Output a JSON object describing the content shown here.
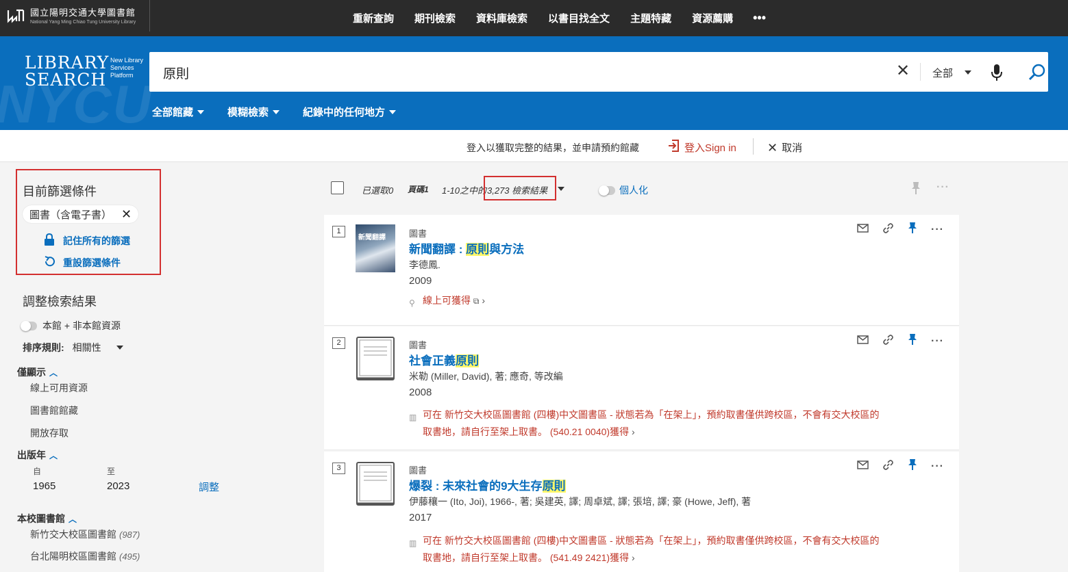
{
  "topbar": {
    "logo_zh": "國立陽明交通大學圖書館",
    "logo_en": "National Yang Ming Chiao Tung University Library",
    "nav": [
      "重新查詢",
      "期刊檢索",
      "資料庫檢索",
      "以書目找全文",
      "主題特藏",
      "資源薦購"
    ],
    "more": "•••"
  },
  "header": {
    "brand_line1": "LIBRARY",
    "brand_line2": "SEARCH",
    "brand_sub": "New Library Services Platform",
    "bg_text": "NYCU",
    "search_value": "原則",
    "scope": "全部",
    "filters": [
      "全部館藏",
      "模糊檢索",
      "紀錄中的任何地方"
    ]
  },
  "signbar": {
    "message": "登入以獲取完整的結果，並申請預約館藏",
    "signin": "登入Sign in",
    "cancel": "取消"
  },
  "left": {
    "current_title": "目前篩選條件",
    "chip": "圖書（含電子書）",
    "remember": "記住所有的篩選",
    "reset": "重設篩選條件",
    "adjust_title": "調整檢索結果",
    "toggle_label": "本館 + 非本館資源",
    "sort_label": "排序規則:",
    "sort_value": "相關性",
    "show_only": "僅顯示",
    "show_only_items": [
      "線上可用資源",
      "圖書館館藏",
      "開放存取"
    ],
    "year_title": "出版年",
    "from_label": "自",
    "to_label": "至",
    "from_value": "1965",
    "to_value": "2023",
    "adjust_btn": "調整",
    "library_title": "本校圖書館",
    "libraries": [
      {
        "name": "新竹交大校區圖書館",
        "count": "(987)"
      },
      {
        "name": "台北陽明校區圖書館",
        "count": "(495)"
      }
    ]
  },
  "results_head": {
    "selected": "已選取0",
    "page": "頁碼1",
    "range_prefix": "1-10之中的",
    "count": "3,273 檢索結果",
    "personalize": "個人化"
  },
  "results": [
    {
      "num": "1",
      "type": "圖書",
      "title_before": "新聞翻譯 : ",
      "title_hl": "原則",
      "title_after": "與方法",
      "author": "李德鳳.",
      "year": "2009",
      "avail_line1": "線上可獲得",
      "avail_line2": "",
      "cover_text": "新聞翻譯"
    },
    {
      "num": "2",
      "type": "圖書",
      "title_before": "社會正義",
      "title_hl": "原則",
      "title_after": "",
      "author": "米勒 (Miller, David), 著; 應奇, 等改編",
      "year": "2008",
      "avail_line1": "可在 新竹交大校區圖書館 (四樓)中文圖書區 - 狀態若為「在架上」，預約取書僅供跨校區，不會有交大校區的",
      "avail_line2": "取書地，請自行至架上取書。 (540.21 0040)獲得"
    },
    {
      "num": "3",
      "type": "圖書",
      "title_before": "爆裂 : 未來社會的9大生存",
      "title_hl": "原則",
      "title_after": "",
      "author": "伊藤穰一 (Ito, Joi), 1966-, 著; 吳建英, 譯; 周卓斌, 譯; 張培, 譯; 豪 (Howe, Jeff), 著",
      "year": "2017",
      "avail_line1": "可在 新竹交大校區圖書館 (四樓)中文圖書區 - 狀態若為「在架上」，預約取書僅供跨校區，不會有交大校區的",
      "avail_line2": "取書地，請自行至架上取書。 (541.49 2421)獲得"
    }
  ],
  "colors": {
    "accent": "#0a6ebd",
    "highlight_box": "#d32f2f",
    "avail": "#c0392b"
  }
}
